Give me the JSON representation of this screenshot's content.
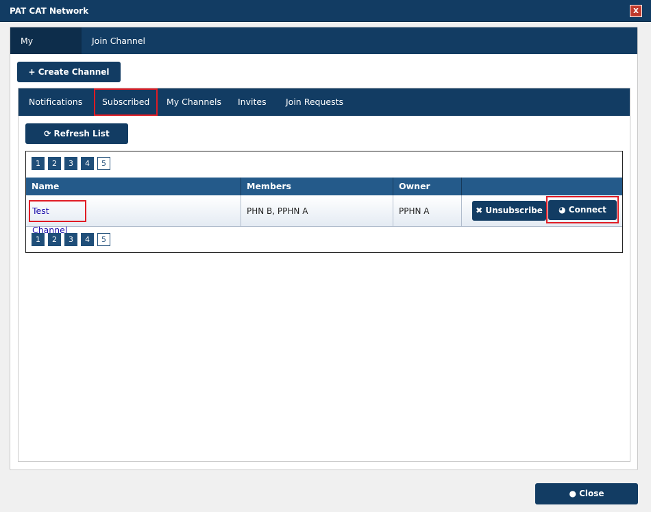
{
  "window": {
    "title": "PAT CAT Network",
    "close_glyph": "x"
  },
  "outer_tabs": [
    {
      "label": "My Channels"
    },
    {
      "label": "Join Channel"
    }
  ],
  "create_button": {
    "icon": "+",
    "label": "Create Channel"
  },
  "inner_tabs": [
    {
      "label": "Notifications"
    },
    {
      "label": "Subscribed"
    },
    {
      "label": "My Channels"
    },
    {
      "label": "Invites"
    },
    {
      "label": "Join Requests"
    }
  ],
  "refresh_button": {
    "icon": "⟳",
    "label": "Refresh List"
  },
  "pager": {
    "pages": [
      "1",
      "2",
      "3",
      "4",
      "5"
    ],
    "current": "5"
  },
  "table": {
    "headers": [
      "Name",
      "Members",
      "Owner",
      ""
    ],
    "rows": [
      {
        "name": "Test Channel",
        "members": "PHN B, PPHN A",
        "owner": "PPHN A"
      }
    ],
    "unsubscribe": {
      "icon": "✖",
      "label": "Unsubscribe"
    },
    "connect": {
      "icon": "◕",
      "label": "Connect"
    }
  },
  "close_button": {
    "icon": "●",
    "label": "Close"
  },
  "colors": {
    "primary": "#123c63",
    "header": "#245a8a",
    "highlight": "#e01b24",
    "link": "#1a0dab"
  }
}
